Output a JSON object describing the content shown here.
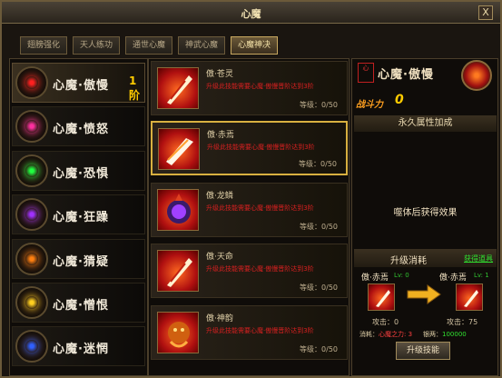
{
  "window": {
    "title": "心魔",
    "close_label": "X"
  },
  "tabs": [
    {
      "label": "翅膀强化",
      "active": false
    },
    {
      "label": "天人练功",
      "active": false
    },
    {
      "label": "通世心魔",
      "active": false
    },
    {
      "label": "神武心魔",
      "active": false
    },
    {
      "label": "心魔神决",
      "active": true
    }
  ],
  "demons": [
    {
      "name": "心魔·傲慢",
      "level": "1阶",
      "color": "#ff2020",
      "active": true
    },
    {
      "name": "心魔·愤怒",
      "level": "",
      "color": "#ff30a0",
      "active": false
    },
    {
      "name": "心魔·恐惧",
      "level": "",
      "color": "#20ff40",
      "active": false
    },
    {
      "name": "心魔·狂躁",
      "level": "",
      "color": "#a030ff",
      "active": false
    },
    {
      "name": "心魔·猜疑",
      "level": "",
      "color": "#ff8010",
      "active": false
    },
    {
      "name": "心魔·憎恨",
      "level": "",
      "color": "#ffd020",
      "active": false
    },
    {
      "name": "心魔·迷惘",
      "level": "",
      "color": "#3060ff",
      "active": false
    }
  ],
  "skills": [
    {
      "name": "傲·苍灵",
      "desc": "升级此技能需要心魔·傲慢晋阶达到3阶",
      "grade": "等级：0/50",
      "icon": "feather"
    },
    {
      "name": "傲·赤焉",
      "desc": "升级此技能需要心魔·傲慢晋阶达到3阶",
      "grade": "等级：0/50",
      "icon": "blade"
    },
    {
      "name": "傲·龙鳞",
      "desc": "升级此技能需要心魔·傲慢晋阶达到3阶",
      "grade": "等级：0/50",
      "icon": "orb"
    },
    {
      "name": "傲·天命",
      "desc": "升级此技能需要心魔·傲慢晋阶达到3阶",
      "grade": "等级：0/50",
      "icon": "feather"
    },
    {
      "name": "傲·神韵",
      "desc": "升级此技能需要心魔·傲慢晋阶达到3阶",
      "grade": "等级：0/50",
      "icon": "beast"
    }
  ],
  "detail": {
    "badge": "心",
    "title": "心魔·傲慢",
    "power_label": "战斗力",
    "power_value": "0",
    "attr_header": "永久属性加成",
    "unlock_text": "噬体后获得效果"
  },
  "upgrade": {
    "title": "升级消耗",
    "link": "获得道具",
    "current": {
      "name": "傲·赤焉",
      "lv": "Lv: 0",
      "stat": "攻击：0"
    },
    "next": {
      "name": "傲·赤焉",
      "lv": "Lv: 1",
      "stat": "攻击：75"
    },
    "cost_label": "消耗：",
    "cost_item": "心魔之力: 3",
    "silver_label": "银两：",
    "silver_value": "100000",
    "button": "升级技能"
  },
  "colors": {
    "accent": "#d8b040",
    "warning": "#d82020",
    "gold": "#ffcc00"
  }
}
